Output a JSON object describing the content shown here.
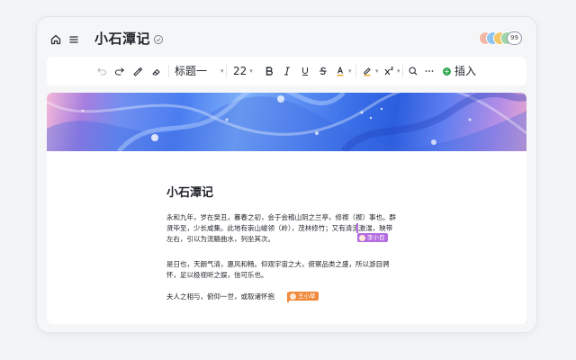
{
  "document": {
    "title": "小石潭记",
    "heading": "小石潭记",
    "paragraphs": [
      "永和九年，岁在癸丑，暮春之初，会于会稽山阴之兰亭，修禊（禊）事也。群贤毕至，少长咸集。此地有崇山峻领（岭），茂林修竹；又有清流激湍，映带左右，引以为流觞曲水，列坐其次。",
      "是日也，天朗气清，惠风和畅。仰观宇宙之大，俯察品类之盛，所以游目骋怀，足以极视听之娱，信可乐也。",
      "夫人之相与，俯仰一世，或取诸怀抱"
    ]
  },
  "collaborators": {
    "count": "99",
    "cursors": [
      {
        "name": "李小目",
        "color": "#b46ce0"
      },
      {
        "name": "王小草",
        "color": "#f08a3c"
      }
    ]
  },
  "toolbar": {
    "heading_select": "标题一",
    "font_size": "22",
    "insert_label": "插入"
  },
  "colors": {
    "accent_green": "#33a852",
    "text_color_underline": "#f3a51f",
    "highlight_underline": "#f3a51f"
  }
}
